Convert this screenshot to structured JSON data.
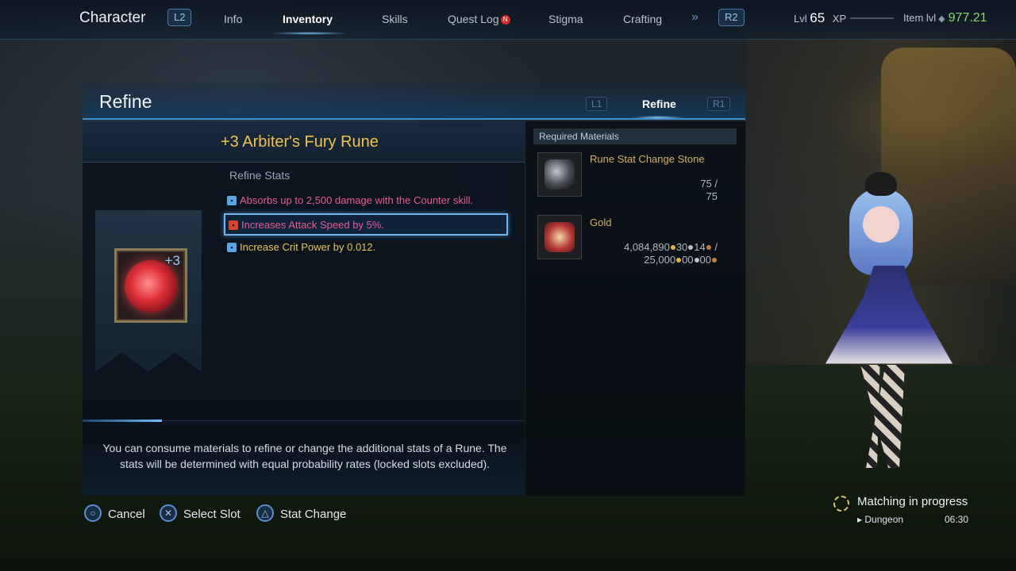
{
  "topnav": {
    "title": "Character",
    "left_button": "L2",
    "right_button": "R2",
    "tabs": [
      {
        "label": "Info"
      },
      {
        "label": "Inventory"
      },
      {
        "label": "Skills"
      },
      {
        "label": "Quest Log"
      },
      {
        "label": "Stigma"
      },
      {
        "label": "Crafting"
      }
    ],
    "active_tab": "Inventory",
    "quest_badge": "N",
    "lvl_label": "Lvl",
    "lvl_value": "65",
    "xp_label": "XP",
    "item_lvl_label": "Item lvl",
    "item_lvl_value": "977.21"
  },
  "refine": {
    "title": "Refine",
    "tab_left": "L1",
    "tab_active": "Refine",
    "tab_right": "R1",
    "item_name": "+3 Arbiter's Fury Rune",
    "rune_level": "+3",
    "stats_label": "Refine Stats",
    "stats": [
      {
        "text": "Absorbs up to 2,500 damage with the Counter skill.",
        "locked": true
      },
      {
        "text": "Increases Attack Speed by 5%.",
        "locked": false,
        "selected": true
      },
      {
        "text": "Increase Crit Power by 0.012.",
        "locked": true
      }
    ],
    "progress": 0.18,
    "info_text": "You can consume materials to refine or change the additional stats of a Rune. The stats will be determined with equal probability rates (locked slots excluded).",
    "required_label": "Required Materials",
    "materials": [
      {
        "name": "Rune Stat Change Stone",
        "have": "75 /",
        "need": "75"
      },
      {
        "name": "Gold",
        "have": {
          "gold": "4,084,890",
          "silver": "30",
          "copper": "14"
        },
        "need": {
          "gold": "25,000",
          "silver": "00",
          "copper": "00"
        }
      }
    ]
  },
  "controls": {
    "cancel": "Cancel",
    "select_slot": "Select Slot",
    "stat_change": "Stat Change"
  },
  "matching": {
    "text": "Matching in progress",
    "type": "Dungeon",
    "time": "06:30"
  },
  "colors": {
    "accent": "#3b8fd0",
    "item_name": "#f0c24f",
    "stat_pink": "#e85a95",
    "stat_yellow": "#e8c35a",
    "item_lvl": "#8ad46a"
  }
}
